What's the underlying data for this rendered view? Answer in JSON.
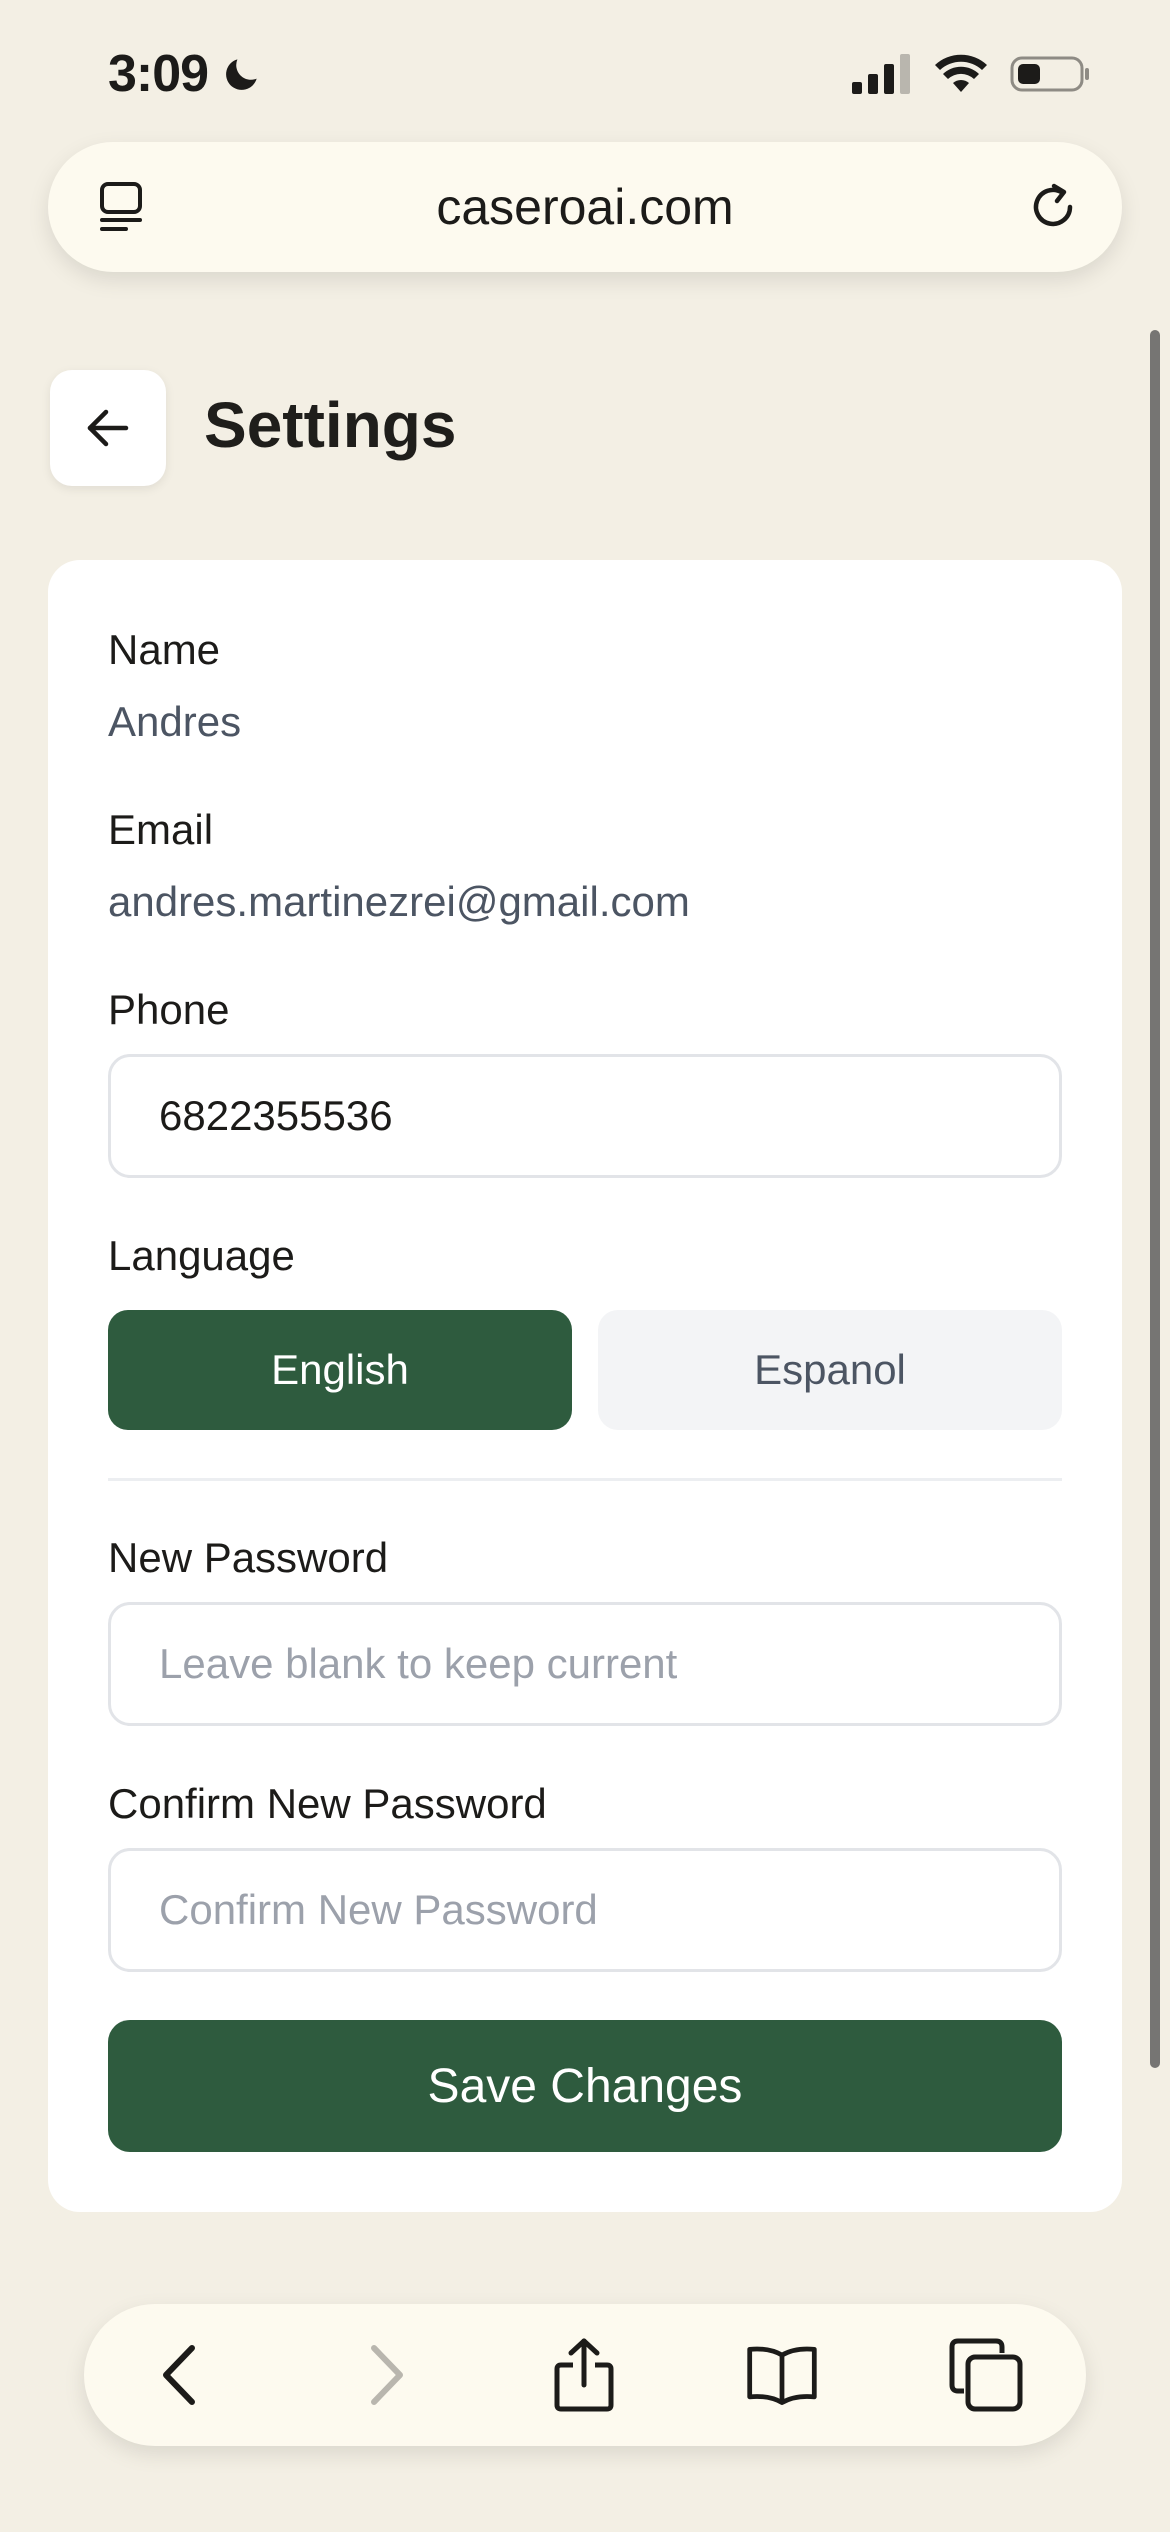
{
  "status_bar": {
    "time": "3:09",
    "icons": [
      "moon-icon",
      "cellular-signal-icon",
      "wifi-icon",
      "battery-icon"
    ]
  },
  "browser": {
    "url": "caseroai.com",
    "left_icon": "tab-overview-icon",
    "right_icon": "reload-icon",
    "toolbar_icons": [
      "back-icon",
      "forward-icon",
      "share-icon",
      "bookmarks-icon",
      "tabs-icon"
    ]
  },
  "header": {
    "title": "Settings",
    "back_icon": "arrow-left-icon"
  },
  "form": {
    "name_label": "Name",
    "name_value": "Andres",
    "email_label": "Email",
    "email_value": "andres.martinezrei@gmail.com",
    "phone_label": "Phone",
    "phone_value": "6822355536",
    "language_label": "Language",
    "language_options": [
      "English",
      "Espanol"
    ],
    "language_selected": "English",
    "new_password_label": "New Password",
    "new_password_placeholder": "Leave blank to keep current",
    "confirm_password_label": "Confirm New Password",
    "confirm_password_placeholder": "Confirm New Password",
    "save_label": "Save Changes"
  },
  "colors": {
    "background": "#f3efe4",
    "accent": "#2e5b3e",
    "card": "#ffffff",
    "muted_text": "#4c5563",
    "placeholder": "#9ca1ab"
  }
}
